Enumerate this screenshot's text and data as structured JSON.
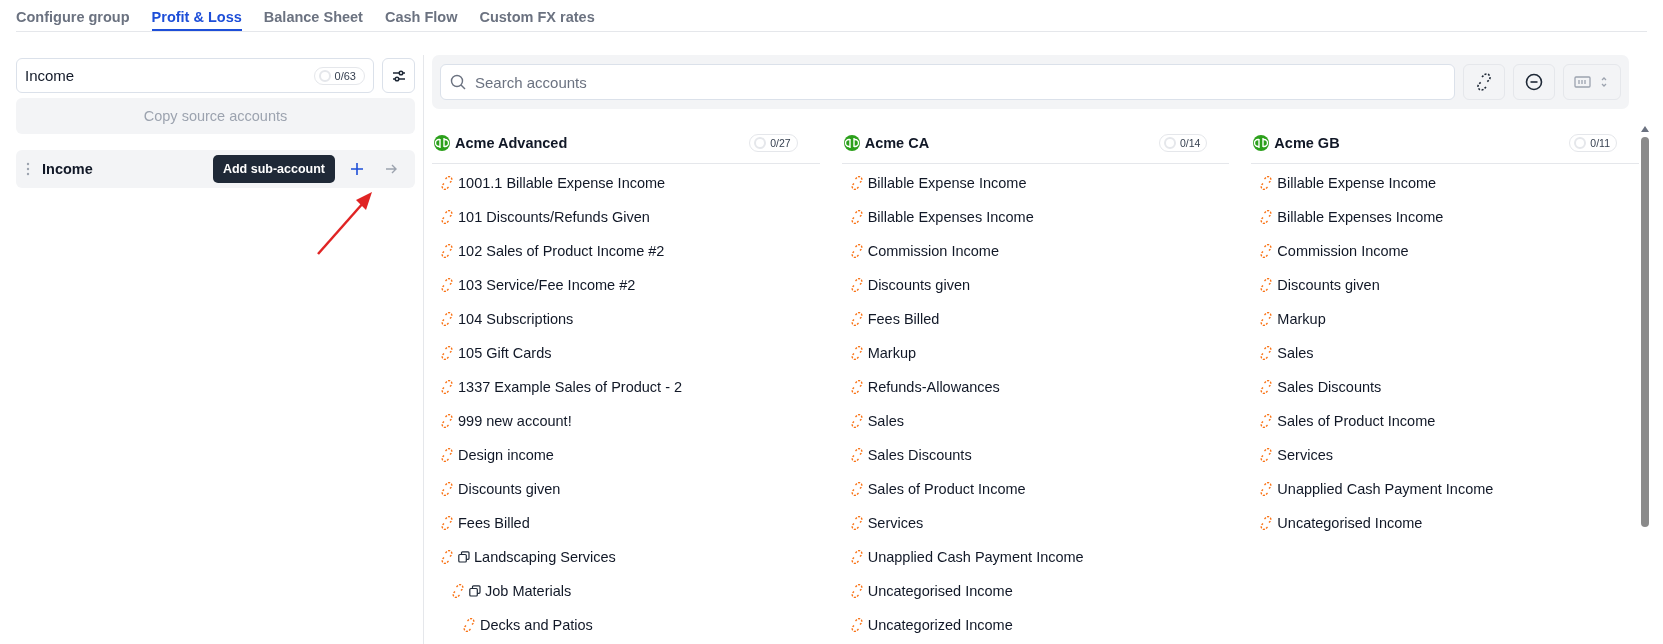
{
  "tabs": [
    {
      "label": "Configure group",
      "selected": false
    },
    {
      "label": "Profit & Loss",
      "selected": true
    },
    {
      "label": "Balance Sheet",
      "selected": false
    },
    {
      "label": "Cash Flow",
      "selected": false
    },
    {
      "label": "Custom FX rates",
      "selected": false
    }
  ],
  "group_panel": {
    "name_field": {
      "value": "Income",
      "count": "0/63"
    },
    "copy_button": "Copy source accounts",
    "groups": [
      {
        "name": "Income",
        "tooltip": "Add sub-account"
      }
    ]
  },
  "search": {
    "placeholder": "Search accounts"
  },
  "sources": [
    {
      "name": "Acme Advanced",
      "count": "0/27",
      "accounts": [
        {
          "name": "1001.1 Billable Expense Income"
        },
        {
          "name": "101 Discounts/Refunds Given"
        },
        {
          "name": "102 Sales of Product Income #2"
        },
        {
          "name": "103 Service/Fee Income #2"
        },
        {
          "name": "104 Subscriptions"
        },
        {
          "name": "105 Gift Cards"
        },
        {
          "name": "1337 Example Sales of Product - 2"
        },
        {
          "name": "999 new account!"
        },
        {
          "name": "Design income"
        },
        {
          "name": "Discounts given"
        },
        {
          "name": "Fees Billed"
        },
        {
          "name": "Landscaping Services",
          "children": [
            {
              "name": "Job Materials",
              "children": [
                {
                  "name": "Decks and Patios"
                }
              ]
            }
          ]
        }
      ]
    },
    {
      "name": "Acme CA",
      "count": "0/14",
      "accounts": [
        {
          "name": "Billable Expense Income"
        },
        {
          "name": "Billable Expenses Income"
        },
        {
          "name": "Commission Income"
        },
        {
          "name": "Discounts given"
        },
        {
          "name": "Fees Billed"
        },
        {
          "name": "Markup"
        },
        {
          "name": "Refunds-Allowances"
        },
        {
          "name": "Sales"
        },
        {
          "name": "Sales Discounts"
        },
        {
          "name": "Sales of Product Income"
        },
        {
          "name": "Services"
        },
        {
          "name": "Unapplied Cash Payment Income"
        },
        {
          "name": "Uncategorised Income"
        },
        {
          "name": "Uncategorized Income"
        }
      ]
    },
    {
      "name": "Acme GB",
      "count": "0/11",
      "accounts": [
        {
          "name": "Billable Expense Income"
        },
        {
          "name": "Billable Expenses Income"
        },
        {
          "name": "Commission Income"
        },
        {
          "name": "Discounts given"
        },
        {
          "name": "Markup"
        },
        {
          "name": "Sales"
        },
        {
          "name": "Sales Discounts"
        },
        {
          "name": "Sales of Product Income"
        },
        {
          "name": "Services"
        },
        {
          "name": "Unapplied Cash Payment Income"
        },
        {
          "name": "Uncategorised Income"
        }
      ]
    }
  ]
}
